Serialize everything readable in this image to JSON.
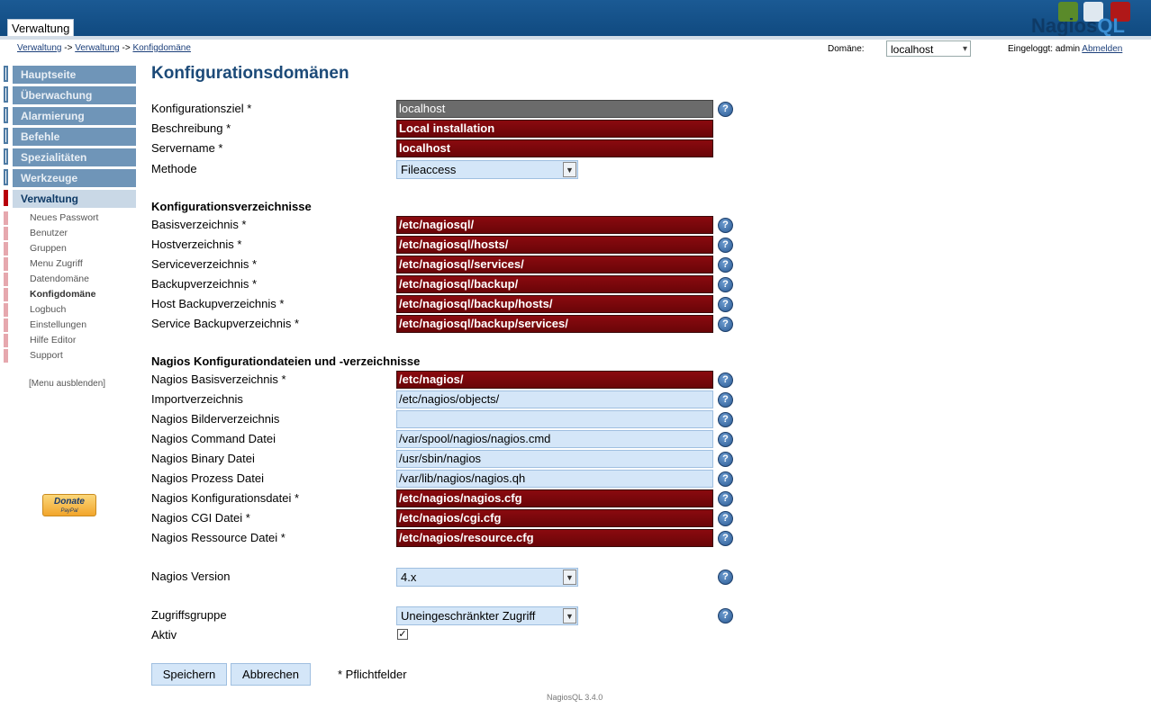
{
  "header": {
    "tab": "Verwaltung",
    "logo_prefix": "Nagios",
    "logo_suffix": "QL"
  },
  "breadcrumb": {
    "items": [
      "Verwaltung",
      "Verwaltung",
      "Konfigdomäne"
    ],
    "sep": "->"
  },
  "domain": {
    "label": "Domäne:",
    "value": "localhost"
  },
  "login": {
    "text": "Eingeloggt: admin",
    "logout": "Abmelden"
  },
  "nav": {
    "items": [
      "Hauptseite",
      "Überwachung",
      "Alarmierung",
      "Befehle",
      "Spezialitäten",
      "Werkzeuge",
      "Verwaltung"
    ],
    "sub": [
      "Neues Passwort",
      "Benutzer",
      "Gruppen",
      "Menu Zugriff",
      "Datendomäne",
      "Konfigdomäne",
      "Logbuch",
      "Einstellungen",
      "Hilfe Editor",
      "Support"
    ],
    "hide": "[Menu ausblenden]"
  },
  "donate": {
    "label": "Donate",
    "sub": "PayPal"
  },
  "page": {
    "title": "Konfigurationsdomänen"
  },
  "form": {
    "basic": [
      {
        "label": "Konfigurationsziel *",
        "value": "localhost"
      },
      {
        "label": "Beschreibung *",
        "value": "Local installation"
      },
      {
        "label": "Servername *",
        "value": "localhost"
      },
      {
        "label": "Methode",
        "value": "Fileaccess"
      }
    ],
    "sec_dirs": "Konfigurationsverzeichnisse",
    "dirs": [
      {
        "label": "Basisverzeichnis *",
        "value": "/etc/nagiosql/"
      },
      {
        "label": "Hostverzeichnis *",
        "value": "/etc/nagiosql/hosts/"
      },
      {
        "label": "Serviceverzeichnis *",
        "value": "/etc/nagiosql/services/"
      },
      {
        "label": "Backupverzeichnis *",
        "value": "/etc/nagiosql/backup/"
      },
      {
        "label": "Host Backupverzeichnis *",
        "value": "/etc/nagiosql/backup/hosts/"
      },
      {
        "label": "Service Backupverzeichnis *",
        "value": "/etc/nagiosql/backup/services/"
      }
    ],
    "sec_nagios": "Nagios Konfigurationdateien und -verzeichnisse",
    "nagios": [
      {
        "label": "Nagios Basisverzeichnis *",
        "value": "/etc/nagios/"
      },
      {
        "label": "Importverzeichnis",
        "value": "/etc/nagios/objects/"
      },
      {
        "label": "Nagios Bilderverzeichnis",
        "value": ""
      },
      {
        "label": "Nagios Command Datei",
        "value": "/var/spool/nagios/nagios.cmd"
      },
      {
        "label": "Nagios Binary Datei",
        "value": "/usr/sbin/nagios"
      },
      {
        "label": "Nagios Prozess Datei",
        "value": "/var/lib/nagios/nagios.qh"
      },
      {
        "label": "Nagios Konfigurationsdatei *",
        "value": "/etc/nagios/nagios.cfg"
      },
      {
        "label": "Nagios CGI Datei *",
        "value": "/etc/nagios/cgi.cfg"
      },
      {
        "label": "Nagios Ressource Datei *",
        "value": "/etc/nagios/resource.cfg"
      }
    ],
    "version": {
      "label": "Nagios Version",
      "value": "4.x"
    },
    "access": {
      "label": "Zugriffsgruppe",
      "value": "Uneingeschränkter Zugriff"
    },
    "active": {
      "label": "Aktiv",
      "checked": true
    }
  },
  "buttons": {
    "save": "Speichern",
    "cancel": "Abbrechen"
  },
  "required_note": "* Pflichtfelder",
  "footer": "NagiosQL 3.4.0",
  "colors": {
    "header": "#1b5a94",
    "required_field": "#7a080c",
    "optional_field": "#d4e6f8",
    "nav": "#6f95b8"
  }
}
